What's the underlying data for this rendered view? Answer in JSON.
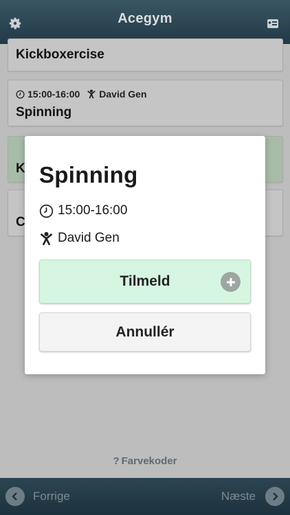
{
  "header": {
    "title": "Acegym",
    "settings_icon": "gear-icon",
    "profile_icon": "profile-card-icon"
  },
  "list": {
    "items": [
      {
        "time": "",
        "teacher": "",
        "name": "Kickboxercise"
      },
      {
        "time": "15:00-16:00",
        "teacher": "David Gen",
        "name": "Spinning"
      },
      {
        "time": "",
        "teacher": "",
        "name": "K",
        "status_color": "#a7bca9"
      },
      {
        "time": "",
        "teacher": "",
        "name": "C"
      }
    ]
  },
  "footer": {
    "color_codes": "Farvekoder",
    "prev_label": "Forrige",
    "next_label": "Næste"
  },
  "modal": {
    "title": "Spinning",
    "time": "15:00-16:00",
    "teacher": "David Gen",
    "signup_label": "Tilmeld",
    "cancel_label": "Annullér",
    "signup_color": "#d6f6e1"
  }
}
